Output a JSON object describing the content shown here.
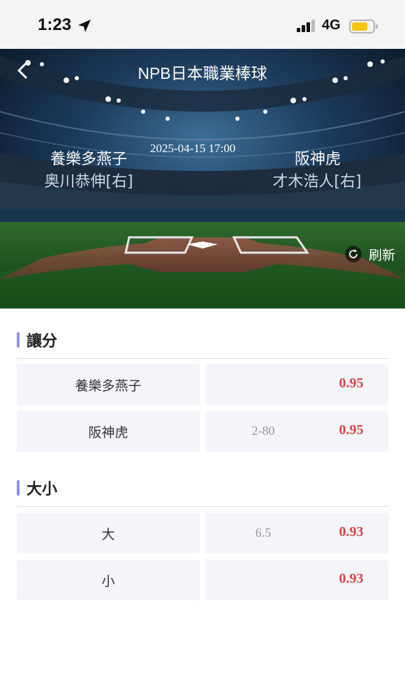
{
  "status_bar": {
    "time": "1:23",
    "network": "4G",
    "icons": [
      "location-arrow-icon",
      "signal-bars-icon",
      "battery-icon"
    ],
    "battery_color": "#f5c518"
  },
  "header": {
    "title": "NPB日本職業棒球",
    "back_icon": "chevron-left-icon"
  },
  "match": {
    "datetime": "2025-04-15 17:00",
    "home_team": "養樂多燕子",
    "home_pitcher": "奥川恭伸[右]",
    "away_team": "阪神虎",
    "away_pitcher": "才木浩人[右]",
    "refresh_label": "刷新"
  },
  "handicap": {
    "title": "讓分",
    "rows": [
      {
        "team": "養樂多燕子",
        "line": "",
        "odds": "0.95"
      },
      {
        "team": "阪神虎",
        "line": "2-80",
        "odds": "0.95"
      }
    ]
  },
  "total": {
    "title": "大小",
    "rows": [
      {
        "side": "大",
        "line": "6.5",
        "odds": "0.93"
      },
      {
        "side": "小",
        "line": "",
        "odds": "0.93"
      }
    ]
  },
  "colors": {
    "accent_bar": "#8b8ff0",
    "odds": "#d64545",
    "cell_bg": "#f4f4fb"
  }
}
